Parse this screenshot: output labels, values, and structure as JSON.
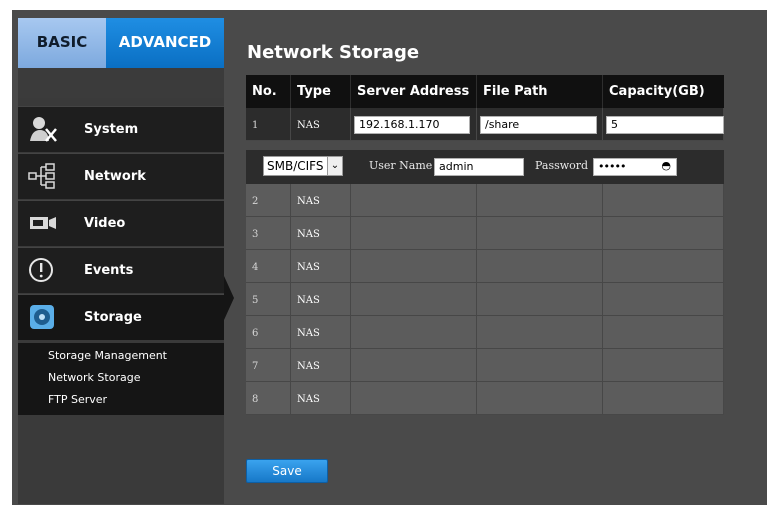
{
  "sidebar": {
    "tabs": [
      {
        "label": "BASIC"
      },
      {
        "label": "ADVANCED"
      }
    ],
    "items": [
      {
        "label": "System",
        "icon": "system-tools-icon"
      },
      {
        "label": "Network",
        "icon": "network-icon"
      },
      {
        "label": "Video",
        "icon": "video-camera-icon"
      },
      {
        "label": "Events",
        "icon": "alert-icon"
      },
      {
        "label": "Storage",
        "icon": "storage-disk-icon"
      }
    ],
    "storage_submenu": [
      "Storage Management",
      "Network Storage",
      "FTP Server"
    ]
  },
  "main": {
    "title": "Network Storage",
    "table": {
      "headers": [
        "No.",
        "Type",
        "Server Address",
        "File Path",
        "Capacity(GB)"
      ],
      "rows": [
        {
          "no": "1",
          "type": "NAS",
          "server": "192.168.1.170",
          "path": "/share",
          "capacity": "5"
        },
        {
          "no": "2",
          "type": "NAS"
        },
        {
          "no": "3",
          "type": "NAS"
        },
        {
          "no": "4",
          "type": "NAS"
        },
        {
          "no": "5",
          "type": "NAS"
        },
        {
          "no": "6",
          "type": "NAS"
        },
        {
          "no": "7",
          "type": "NAS"
        },
        {
          "no": "8",
          "type": "NAS"
        }
      ]
    },
    "auth": {
      "protocol": "SMB/CIFS",
      "username_label": "User Name",
      "username": "admin",
      "password_label": "Password",
      "password_mask": "•••••"
    },
    "save_label": "Save"
  },
  "colors": {
    "accent": "#1f8ee3",
    "sidebar_bg": "#1e1e1e",
    "content_bg": "#4a4a4a"
  }
}
